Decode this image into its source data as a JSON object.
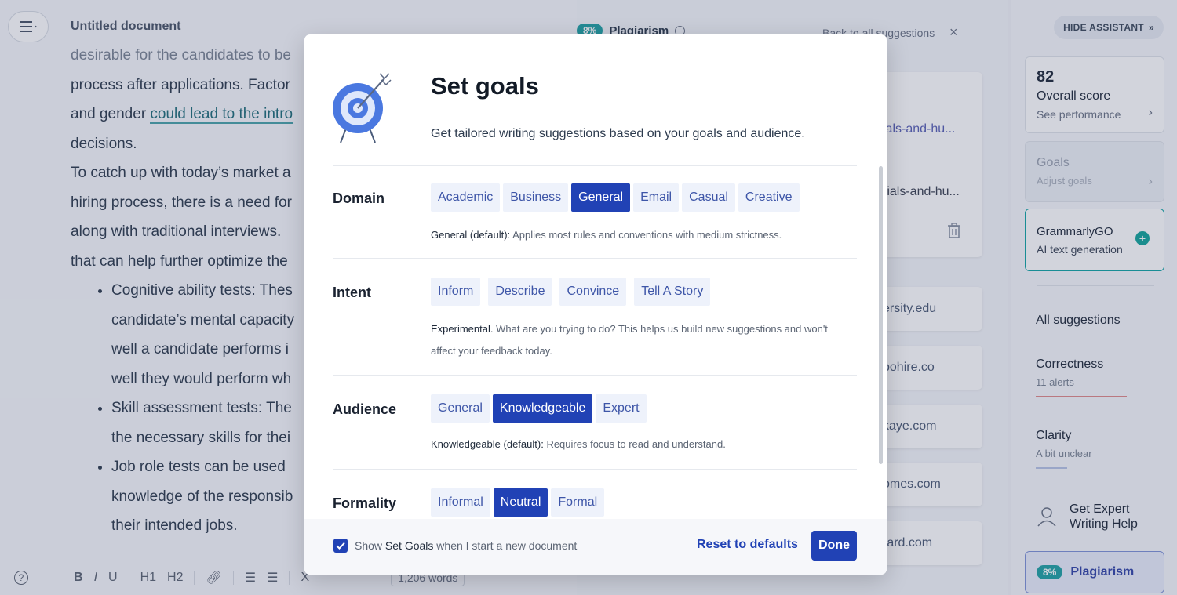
{
  "editor": {
    "title": "Untitled document",
    "lines": [
      "desirable for the candidates to be",
      "process after applications. Factor",
      "and gender ",
      "decisions.",
      "To catch up with today’s market a",
      "hiring process, there is a need for",
      "along with traditional interviews.",
      "that can help further optimize the"
    ],
    "highlight": "could lead to the intro",
    "bullets": [
      [
        "Cognitive ability tests: Thes",
        "candidate’s mental capacity",
        "well a candidate performs i",
        "well they would perform wh"
      ],
      [
        "Skill assessment tests: The",
        "the necessary skills for thei"
      ],
      [
        "Job role tests can be used",
        "knowledge of the responsib",
        "their intended jobs."
      ]
    ],
    "toolbar": {
      "help": "?",
      "bold": "B",
      "italic": "I",
      "underline": "U",
      "h1": "H1",
      "h2": "H2",
      "clear": "X",
      "word_count": "1,206 words"
    }
  },
  "middle": {
    "plag_badge": "8%",
    "plag_title": "Plagiarism",
    "back_link": "Back to all suggestions",
    "close": "×",
    "big_card_line1": "ials-and-hu...",
    "big_card_line2": "rials-and-hu...",
    "cards": [
      "ersity.edu",
      "bohire.co",
      "kaye.com",
      "omes.com",
      "rard.com"
    ]
  },
  "sidebar": {
    "hide_label": "HIDE ASSISTANT",
    "score": "82",
    "score_label": "Overall score",
    "score_sub": "See performance",
    "goals_title": "Goals",
    "goals_sub": "Adjust goals",
    "go_title": "GrammarlyGO",
    "go_sub": "AI text generation",
    "all_suggestions": "All suggestions",
    "categories": [
      {
        "title": "Correctness",
        "sub": "11 alerts",
        "color": "#e08a8a"
      },
      {
        "title": "Clarity",
        "sub": "A bit unclear",
        "color": "#b8c4e6"
      }
    ],
    "expert_line1": "Get Expert",
    "expert_line2": "Writing Help",
    "plag_badge": "8%",
    "plag_label": "Plagiarism"
  },
  "modal": {
    "title": "Set goals",
    "subtitle": "Get tailored writing suggestions based on your goals and audience.",
    "sections": {
      "domain": {
        "label": "Domain",
        "options": [
          "Academic",
          "Business",
          "General",
          "Email",
          "Casual",
          "Creative"
        ],
        "selected": "General",
        "desc_strong": "General (default):",
        "desc": " Applies most rules and conventions with medium strictness."
      },
      "intent": {
        "label": "Intent",
        "options": [
          "Inform",
          "Describe",
          "Convince",
          "Tell A Story"
        ],
        "desc_strong": "Experimental.",
        "desc": " What are you trying to do? This helps us build new suggestions and won't affect your feedback today."
      },
      "audience": {
        "label": "Audience",
        "options": [
          "General",
          "Knowledgeable",
          "Expert"
        ],
        "selected": "Knowledgeable",
        "desc_strong": "Knowledgeable (default):",
        "desc": " Requires focus to read and understand."
      },
      "formality": {
        "label": "Formality",
        "options": [
          "Informal",
          "Neutral",
          "Formal"
        ],
        "selected": "Neutral"
      }
    },
    "footer": {
      "checkbox_checked": true,
      "checkbox_pre": "Show ",
      "checkbox_strong": "Set Goals",
      "checkbox_post": " when I start a new document",
      "reset": "Reset to defaults",
      "done": "Done"
    }
  },
  "colors": {
    "accent": "#2142b5",
    "teal": "#21a2a4",
    "target_blue": "#4a78e0"
  }
}
